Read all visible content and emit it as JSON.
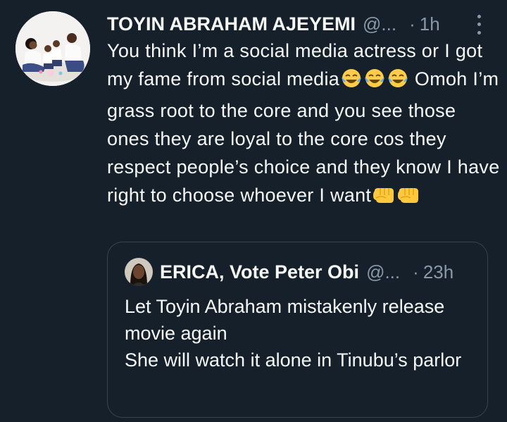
{
  "tweet": {
    "author_name": "TOYIN ABRAHAM AJEYEMI",
    "author_handle": "@...",
    "dot": "·",
    "time": "1h",
    "text_before_laugh": "You think I’m a social media actress or I got my fame from social media",
    "text_middle": " Omoh I’m grass root to the core and you see those ones they are loyal to the core cos they respect people’s choice and they know I have right to choose whoever I want",
    "laugh_emoji": "face-with-tears-of-joy-icon",
    "fist_emoji": "left-facing-fist-icon"
  },
  "quote": {
    "author_name": "ERICA, Vote Peter Obi",
    "author_handle": "@...",
    "dot": "·",
    "time": "23h",
    "text": "Let Toyin Abraham mistakenly release movie again\nShe will watch it alone in Tinubu’s parlor"
  },
  "colors": {
    "background": "#15202b",
    "text_primary": "#f7f9f9",
    "text_secondary": "#8b98a5",
    "border": "#38444d"
  }
}
